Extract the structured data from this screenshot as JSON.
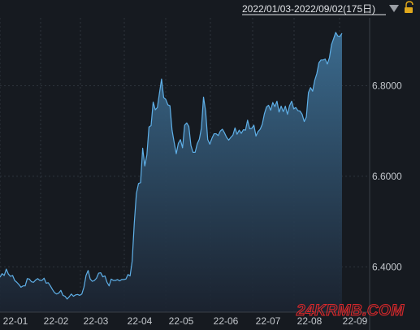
{
  "header": {
    "range_label": "2022/01/03-2022/09/02(175日)",
    "dropdown_icon": "triangle-down-icon",
    "lock_icon": "unlock-icon"
  },
  "watermark": "24KRMB.COM",
  "colors": {
    "background": "#161a20",
    "line": "#5fb0e8",
    "fill_top": "#3d6f94",
    "fill_bottom": "#1b2330",
    "grid": "#2e343c",
    "watermark": "#d8282b",
    "lock": "#e0a81c"
  },
  "chart_data": {
    "type": "area",
    "title": "",
    "xlabel": "",
    "ylabel": "",
    "x_range": [
      "2022-01-03",
      "2022-09-02"
    ],
    "ylim": [
      6.3,
      6.95
    ],
    "y_ticks": [
      6.4,
      6.6,
      6.8
    ],
    "y_tick_labels": [
      "6.4000",
      "6.6000",
      "6.8000"
    ],
    "x_tick_labels": [
      "22-01",
      "22-02",
      "22-03",
      "22-04",
      "22-05",
      "22-06",
      "22-07",
      "22-08",
      "22-09"
    ],
    "grid": true,
    "legend": "none",
    "series": [
      {
        "values": [
          6.377,
          6.385,
          6.381,
          6.395,
          6.384,
          6.379,
          6.381,
          6.37,
          6.366,
          6.361,
          6.355,
          6.358,
          6.358,
          6.374,
          6.373,
          6.367,
          6.366,
          6.371,
          6.374,
          6.37,
          6.37,
          6.375,
          6.364,
          6.365,
          6.358,
          6.35,
          6.343,
          6.34,
          6.342,
          6.348,
          6.337,
          6.335,
          6.329,
          6.334,
          6.34,
          6.335,
          6.338,
          6.339,
          6.337,
          6.34,
          6.355,
          6.381,
          6.392,
          6.373,
          6.368,
          6.37,
          6.375,
          6.386,
          6.387,
          6.378,
          6.38,
          6.366,
          6.358,
          6.373,
          6.37,
          6.37,
          6.372,
          6.369,
          6.372,
          6.372,
          6.373,
          6.383,
          6.38,
          6.413,
          6.497,
          6.562,
          6.584,
          6.586,
          6.662,
          6.623,
          6.647,
          6.709,
          6.712,
          6.764,
          6.747,
          6.752,
          6.784,
          6.815,
          6.774,
          6.77,
          6.758,
          6.756,
          6.702,
          6.675,
          6.65,
          6.673,
          6.681,
          6.663,
          6.713,
          6.718,
          6.71,
          6.668,
          6.653,
          6.653,
          6.672,
          6.682,
          6.707,
          6.775,
          6.744,
          6.681,
          6.671,
          6.684,
          6.694,
          6.694,
          6.69,
          6.7,
          6.704,
          6.696,
          6.686,
          6.68,
          6.686,
          6.691,
          6.707,
          6.693,
          6.702,
          6.695,
          6.703,
          6.702,
          6.724,
          6.705,
          6.706,
          6.713,
          6.689,
          6.699,
          6.704,
          6.715,
          6.738,
          6.753,
          6.757,
          6.746,
          6.763,
          6.754,
          6.766,
          6.742,
          6.755,
          6.743,
          6.755,
          6.737,
          6.756,
          6.766,
          6.749,
          6.752,
          6.745,
          6.744,
          6.737,
          6.721,
          6.731,
          6.785,
          6.796,
          6.788,
          6.812,
          6.827,
          6.851,
          6.857,
          6.857,
          6.859,
          6.848,
          6.862,
          6.891,
          6.904,
          6.918,
          6.91,
          6.909,
          6.916
        ]
      }
    ]
  }
}
